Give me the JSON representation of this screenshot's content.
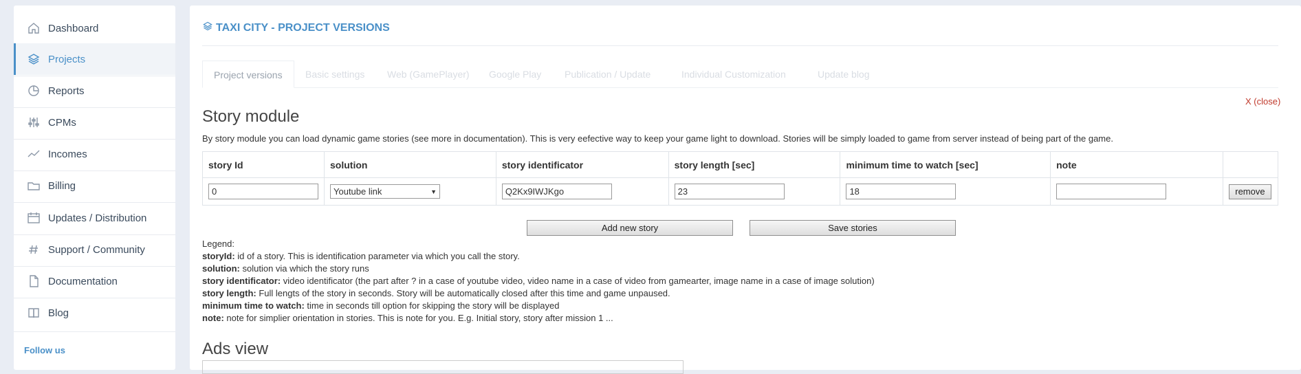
{
  "sidebar": {
    "items": [
      {
        "label": "Dashboard",
        "icon": "home-icon"
      },
      {
        "label": "Projects",
        "icon": "layers-icon"
      },
      {
        "label": "Reports",
        "icon": "pie-chart-icon"
      },
      {
        "label": "CPMs",
        "icon": "sliders-icon"
      },
      {
        "label": "Incomes",
        "icon": "trend-icon"
      },
      {
        "label": "Billing",
        "icon": "folder-icon"
      },
      {
        "label": "Updates / Distribution",
        "icon": "calendar-icon"
      },
      {
        "label": "Support / Community",
        "icon": "hash-icon"
      },
      {
        "label": "Documentation",
        "icon": "document-icon"
      },
      {
        "label": "Blog",
        "icon": "book-icon"
      }
    ],
    "active": "Projects",
    "follow_label": "Follow us"
  },
  "header": {
    "title": "TAXI CITY - PROJECT VERSIONS"
  },
  "tabs": [
    {
      "label": "Project versions",
      "active": true
    },
    {
      "label": "Basic settings",
      "active": false
    },
    {
      "label": "Web (GamePlayer)",
      "active": false
    },
    {
      "label": "Google Play",
      "active": false
    },
    {
      "label": "Publication / Update",
      "active": false
    },
    {
      "label": "Individual Customization",
      "active": false
    },
    {
      "label": "Update blog",
      "active": false
    }
  ],
  "close_label": "X (close)",
  "story_module": {
    "title": "Story module",
    "description": "By story module you can load dynamic game stories (see more in documentation). This is very eefective way to keep your game light to download. Stories will be simply loaded to game from server instead of being part of the game.",
    "columns": [
      "story Id",
      "solution",
      "story identificator",
      "story length [sec]",
      "minimum time to watch [sec]",
      "note"
    ],
    "rows": [
      {
        "story_id": "0",
        "solution": "Youtube link",
        "identificator": "Q2Kx9IWJKgo",
        "length": "23",
        "min_watch": "18",
        "note": "",
        "remove_label": "remove"
      }
    ],
    "add_label": "Add new story",
    "save_label": "Save stories"
  },
  "legend": {
    "heading": "Legend:",
    "items": [
      {
        "term": "storyId:",
        "text": " id of a story. This is identification parameter via which you call the story."
      },
      {
        "term": "solution:",
        "text": " solution via which the story runs"
      },
      {
        "term": "story identificator:",
        "text": " video identificator (the part after ? in a case of youtube video, video name in a case of video from gamearter, image name in a case of image solution)"
      },
      {
        "term": "story length:",
        "text": " Full lengts of the story in seconds. Story will be automatically closed after this time and game unpaused."
      },
      {
        "term": "minimum time to watch:",
        "text": " time in seconds till option for skipping the story will be displayed"
      },
      {
        "term": "note:",
        "text": " note for simplier orientation in stories. This is note for you. E.g. Initial story, story after mission 1 ..."
      }
    ]
  },
  "ads": {
    "title": "Ads view"
  },
  "colors": {
    "accent": "#4a90c8",
    "close": "#c0392b",
    "background": "#e9edf4"
  }
}
